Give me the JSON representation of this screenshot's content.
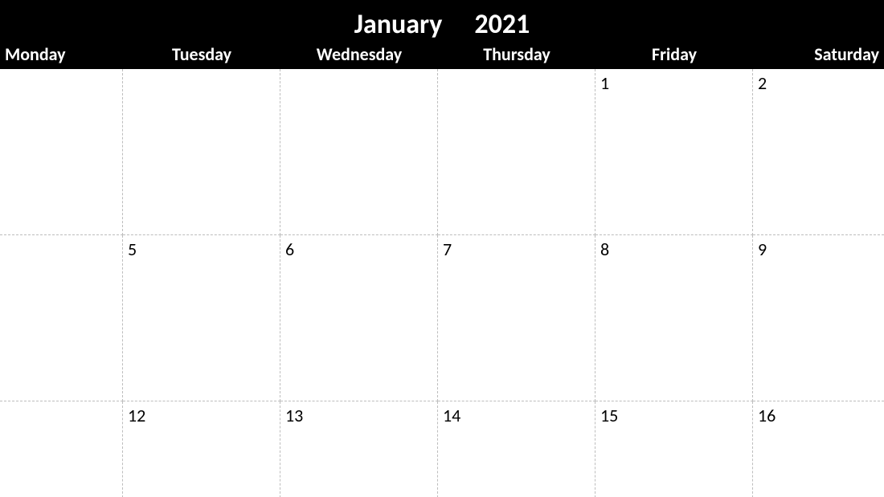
{
  "header": {
    "month": "January",
    "year": "2021"
  },
  "days_of_week": [
    "Monday",
    "Tuesday",
    "Wednesday",
    "Thursday",
    "Friday",
    "Saturday"
  ],
  "weeks": [
    {
      "cells": [
        "",
        "",
        "",
        "",
        "1",
        "2"
      ]
    },
    {
      "cells": [
        "",
        "5",
        "6",
        "7",
        "8",
        "9"
      ]
    },
    {
      "cells": [
        "",
        "12",
        "13",
        "14",
        "15",
        "16"
      ]
    }
  ]
}
